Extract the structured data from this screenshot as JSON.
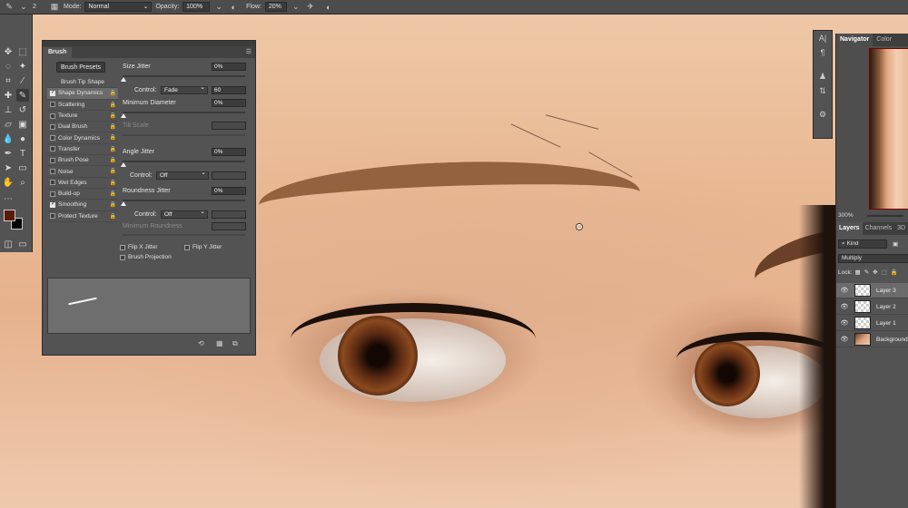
{
  "options_bar": {
    "brush_size": "2",
    "mode_label": "Mode:",
    "mode_value": "Normal",
    "opacity_label": "Opacity:",
    "opacity_value": "100%",
    "flow_label": "Flow:",
    "flow_value": "20%"
  },
  "toolbar": {
    "tools": [
      "move-tool",
      "marquee-tool",
      "lasso-tool",
      "magic-wand-tool",
      "crop-tool",
      "eyedropper-tool",
      "healing-tool",
      "brush-tool",
      "stamp-tool",
      "history-brush-tool",
      "eraser-tool",
      "gradient-tool",
      "blur-tool",
      "dodge-tool",
      "pen-tool",
      "type-tool",
      "path-select-tool",
      "shape-tool",
      "hand-tool",
      "zoom-tool"
    ],
    "foreground_color": "#5a1a0a",
    "background_color": "#000000"
  },
  "brush_panel": {
    "tab": "Brush",
    "presets_button": "Brush Presets",
    "items": [
      {
        "label": "Brush Tip Shape",
        "checkbox": false,
        "header": true
      },
      {
        "label": "Shape Dynamics",
        "checked": true,
        "selected": true
      },
      {
        "label": "Scattering",
        "checked": false
      },
      {
        "label": "Texture",
        "checked": false
      },
      {
        "label": "Dual Brush",
        "checked": false
      },
      {
        "label": "Color Dynamics",
        "checked": false
      },
      {
        "label": "Transfer",
        "checked": false
      },
      {
        "label": "Brush Pose",
        "checked": false
      },
      {
        "label": "Noise",
        "checked": false
      },
      {
        "label": "Wet Edges",
        "checked": false
      },
      {
        "label": "Build-up",
        "checked": false
      },
      {
        "label": "Smoothing",
        "checked": true
      },
      {
        "label": "Protect Texture",
        "checked": false
      }
    ],
    "size_jitter_label": "Size Jitter",
    "size_jitter_value": "0%",
    "control_label": "Control:",
    "control1_value": "Fade",
    "control1_number": "60",
    "min_diameter_label": "Minimum Diameter",
    "min_diameter_value": "0%",
    "tilt_scale_label": "Tilt Scale",
    "angle_jitter_label": "Angle Jitter",
    "angle_jitter_value": "0%",
    "control2_value": "Off",
    "roundness_jitter_label": "Roundness Jitter",
    "roundness_jitter_value": "0%",
    "control3_value": "Off",
    "min_roundness_label": "Minimum Roundness",
    "flip_x_label": "Flip X Jitter",
    "flip_y_label": "Flip Y Jitter",
    "brush_projection_label": "Brush Projection"
  },
  "navigator": {
    "tabs": [
      "Navigator",
      "Color"
    ],
    "zoom": "300%"
  },
  "layers": {
    "tabs": [
      "Layers",
      "Channels",
      "3D"
    ],
    "filter_kind": "Kind",
    "blend_mode": "Multiply",
    "lock_label": "Lock:",
    "items": [
      {
        "name": "Layer 3",
        "selected": true,
        "background": false
      },
      {
        "name": "Layer 2",
        "selected": false,
        "background": false
      },
      {
        "name": "Layer 1",
        "selected": false,
        "background": false
      },
      {
        "name": "Background",
        "selected": false,
        "background": true
      }
    ]
  }
}
